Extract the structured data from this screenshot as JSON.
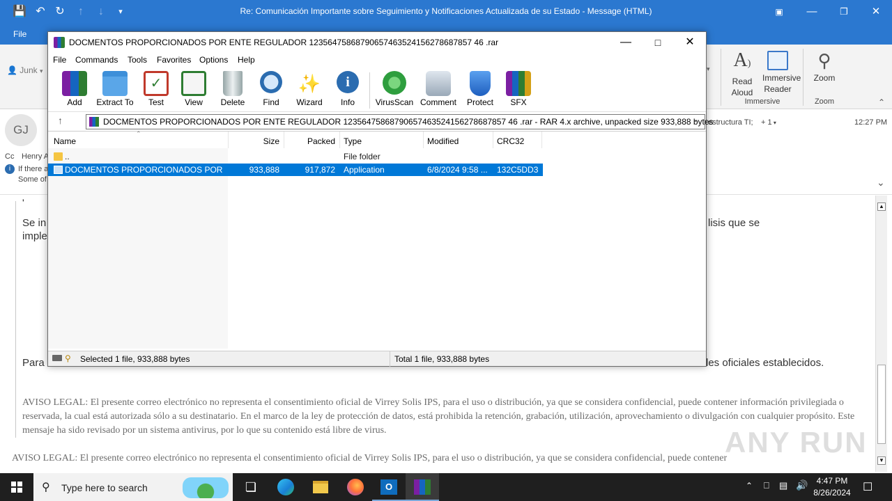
{
  "outlook": {
    "title": "Re: Comunicación Importante sobre Seguimiento y Notificaciones Actualizada de su Estado  -  Message (HTML)",
    "tab_file": "File",
    "junk_label": "Junk",
    "ribbon": {
      "read_aloud": "Read\nAloud",
      "immersive_reader": "Immersive\nReader",
      "immersive_group": "Immersive",
      "zoom": "Zoom",
      "zoom_group": "Zoom"
    },
    "header": {
      "avatar_initials": "GJ",
      "cc_label": "Cc",
      "cc_name": "Henry A",
      "info_line1": "If there a",
      "info_line2": "Some of",
      "to_snippet": "estructura TI;",
      "plus_count": "+ 1",
      "time": "12:27 PM"
    },
    "body": {
      "bullet": "'",
      "para1_left": "Se in",
      "para1_right": "lisis que se",
      "para1_line2": "imple",
      "para2_left": "Para",
      "para2_right": "les oficiales establecidos.",
      "legal1": "AVISO LEGAL: El presente correo electrónico no representa el consentimiento oficial de Virrey Solis IPS, para el uso o distribución, ya que se considera confidencial, puede contener información privilegiada o reservada, la cual está autorizada sólo a su destinatario. En el marco de la ley de protección de datos, está prohibida la retención, grabación, utilización, aprovechamiento o divulgación con cualquier propósito. Este mensaje ha sido revisado por un sistema antivirus, por lo que su contenido está libre de virus.",
      "legal2": "AVISO LEGAL: El presente correo electrónico no representa el consentimiento oficial de Virrey Solis IPS, para el uso o distribución, ya que se considera confidencial, puede contener"
    }
  },
  "winrar": {
    "title": "DOCMENTOS PROPORCIONADOS POR ENTE REGULADOR 12356475868790657463524156278687857 46 .rar",
    "menu": [
      "File",
      "Commands",
      "Tools",
      "Favorites",
      "Options",
      "Help"
    ],
    "toolbar": [
      {
        "label": "Add",
        "icon": "add-archive-icon",
        "color": "#b03a2e"
      },
      {
        "label": "Extract To",
        "icon": "extract-folder-icon",
        "color": "#3d8fd9"
      },
      {
        "label": "Test",
        "icon": "test-clipboard-icon",
        "color": "#c0392b"
      },
      {
        "label": "View",
        "icon": "view-book-icon",
        "color": "#2e7d32"
      },
      {
        "label": "Delete",
        "icon": "trash-icon",
        "color": "#7f8c8d"
      },
      {
        "label": "Find",
        "icon": "magnifier-icon",
        "color": "#2b6cb0"
      },
      {
        "label": "Wizard",
        "icon": "wand-icon",
        "color": "#8e44ad"
      },
      {
        "label": "Info",
        "icon": "info-icon",
        "color": "#2b6cb0"
      },
      {
        "label": "VirusScan",
        "icon": "virus-scan-icon",
        "color": "#2e9e3e"
      },
      {
        "label": "Comment",
        "icon": "comment-icon",
        "color": "#7f8c9a"
      },
      {
        "label": "Protect",
        "icon": "shield-icon",
        "color": "#2b6cd0"
      },
      {
        "label": "SFX",
        "icon": "sfx-box-icon",
        "color": "#d4a017"
      }
    ],
    "address": "DOCMENTOS PROPORCIONADOS POR ENTE REGULADOR 12356475868790657463524156278687857 46 .rar - RAR 4.x archive, unpacked size 933,888 bytes",
    "columns": [
      "Name",
      "Size",
      "Packed",
      "Type",
      "Modified",
      "CRC32"
    ],
    "rows": [
      {
        "name": "..",
        "size": "",
        "packed": "",
        "type": "File folder",
        "modified": "",
        "crc": ""
      },
      {
        "name": "DOCMENTOS PROPORCIONADOS POR E...",
        "size": "933,888",
        "packed": "917,872",
        "type": "Application",
        "modified": "6/8/2024 9:58 ...",
        "crc": "132C5DD3"
      }
    ],
    "status_left": "Selected 1 file, 933,888 bytes",
    "status_right": "Total 1 file, 933,888 bytes"
  },
  "taskbar": {
    "search_placeholder": "Type here to search",
    "time": "4:47 PM",
    "date": "8/26/2024"
  },
  "watermark": "ANY RUN"
}
